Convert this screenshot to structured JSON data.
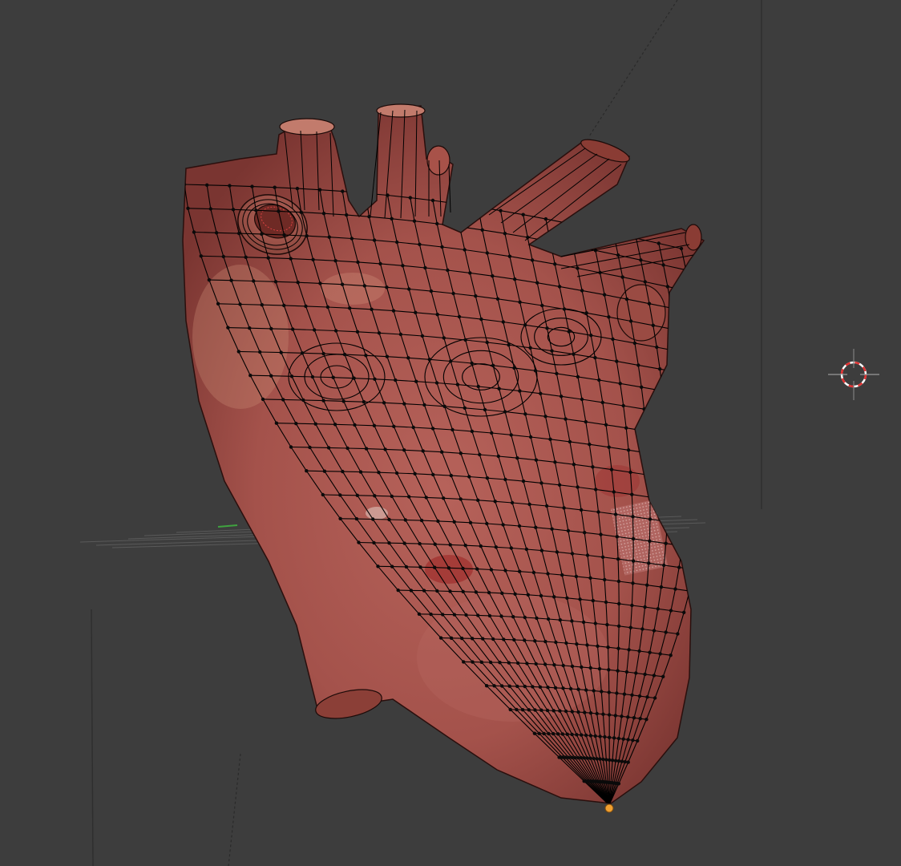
{
  "viewport": {
    "background_color": "#3d3d3d",
    "mode": "edit-mode-wireframe-overlay",
    "object": "heart-mesh"
  },
  "colors": {
    "mesh_base": "#a8564f",
    "mesh_dark": "#6f2f2c",
    "mesh_highlight": "#cf8f7c",
    "wire": "#000000",
    "vertex": "#0a0a0a",
    "active_vertex": "#f0a030",
    "grid_line": "#6a6a6a",
    "cursor_red": "#e03030",
    "cursor_white": "#ffffff"
  },
  "icons": {
    "cursor": "3d-cursor-icon",
    "active_vertex": "active-vertex-icon"
  }
}
